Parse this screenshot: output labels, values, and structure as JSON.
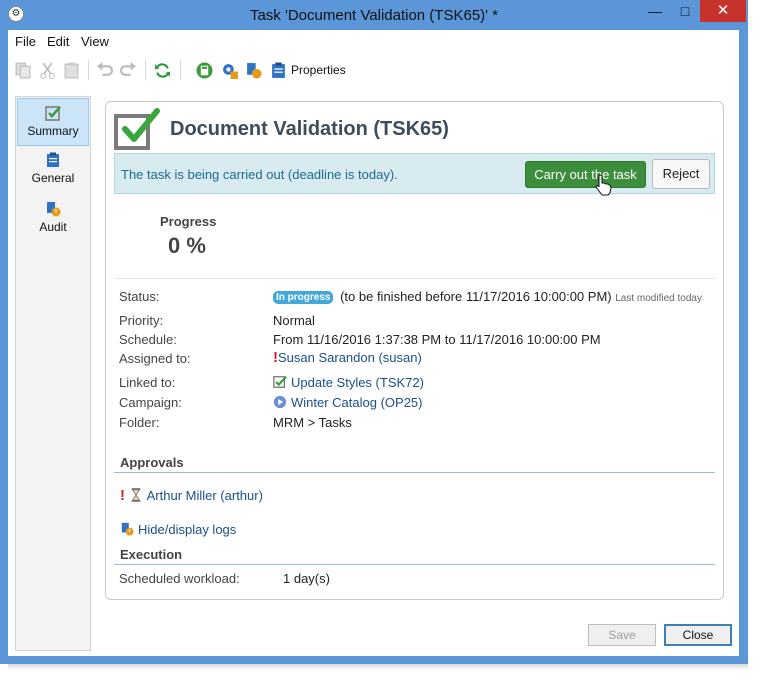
{
  "window": {
    "title": "Task 'Document Validation (TSK65)' *",
    "minimize": "—",
    "maximize": "□",
    "close": "✕"
  },
  "menu": [
    "File",
    "Edit",
    "View"
  ],
  "toolbar": {
    "properties_label": "Properties"
  },
  "sidebar": [
    {
      "label": "Summary",
      "icon": "check-icon",
      "active": true
    },
    {
      "label": "General",
      "icon": "clipboard-icon",
      "active": false
    },
    {
      "label": "Audit",
      "icon": "audit-icon",
      "active": false
    }
  ],
  "task": {
    "title": "Document Validation (TSK65)",
    "banner_text": "The task is being carried out (deadline is today).",
    "carry_out_label": "Carry out the task",
    "reject_label": "Reject"
  },
  "progress": {
    "label": "Progress",
    "value": "0 %"
  },
  "details": {
    "status_label": "Status:",
    "status_badge": "In progress",
    "status_text": "(to be finished before 11/17/2016 10:00:00 PM)",
    "last_modified": "Last modified today",
    "priority_label": "Priority:",
    "priority_value": "Normal",
    "schedule_label": "Schedule:",
    "schedule_value": "From 11/16/2016 1:37:38 PM to 11/17/2016 10:00:00 PM",
    "assigned_label": "Assigned to:",
    "assigned_value": "Susan Sarandon (susan)",
    "linked_label": "Linked to:",
    "linked_value": "Update Styles (TSK72)",
    "campaign_label": "Campaign:",
    "campaign_value": "Winter Catalog (OP25)",
    "folder_label": "Folder:",
    "folder_value": "MRM > Tasks"
  },
  "approvals": {
    "heading": "Approvals",
    "approver": "Arthur Miller (arthur)",
    "logs_link": "Hide/display logs"
  },
  "execution": {
    "heading": "Execution",
    "workload_label": "Scheduled workload:",
    "workload_value": "1 day(s)"
  },
  "footer": {
    "save_label": "Save",
    "close_label": "Close"
  },
  "colors": {
    "titlebar": "#5b96d8",
    "accent_green": "#3c8d3c",
    "banner": "#d7ebf1",
    "link": "#1b4f8c",
    "badge": "#43a7d9"
  }
}
